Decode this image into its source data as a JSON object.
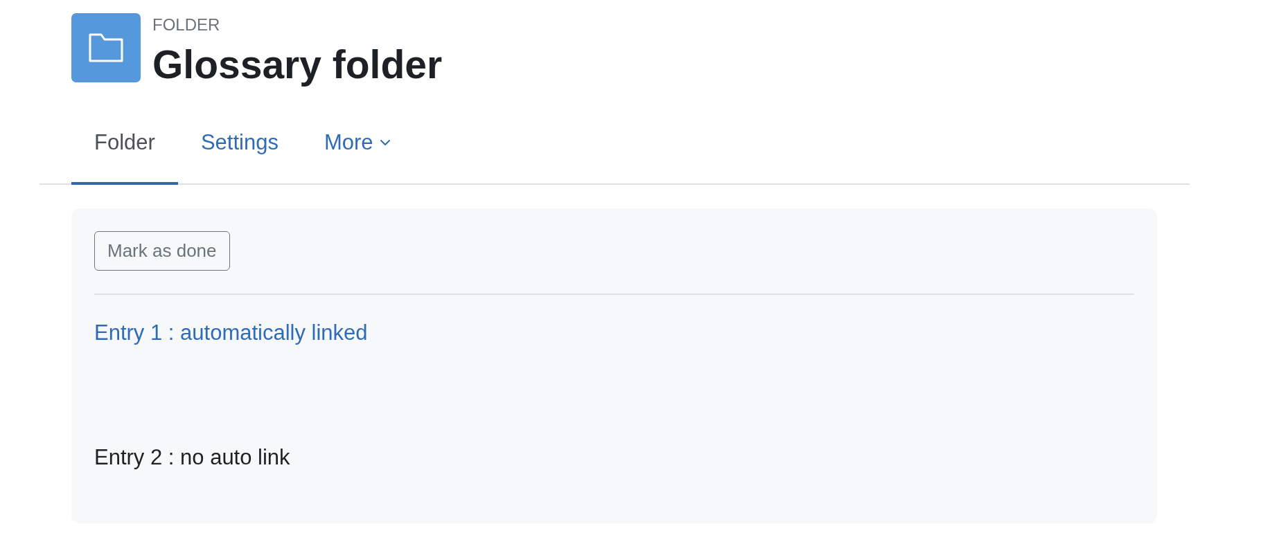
{
  "header": {
    "kind_label": "FOLDER",
    "title": "Glossary folder"
  },
  "tabs": [
    {
      "label": "Folder",
      "selected": true,
      "dropdown": false
    },
    {
      "label": "Settings",
      "selected": false,
      "dropdown": false
    },
    {
      "label": "More",
      "selected": false,
      "dropdown": true
    }
  ],
  "content": {
    "button": {
      "label": "Mark as done"
    },
    "entries": [
      {
        "kind": "link",
        "text": "Entry 1 : automatically linked"
      },
      {
        "kind": "text",
        "text": "Entry 2 : no auto link"
      }
    ]
  }
}
